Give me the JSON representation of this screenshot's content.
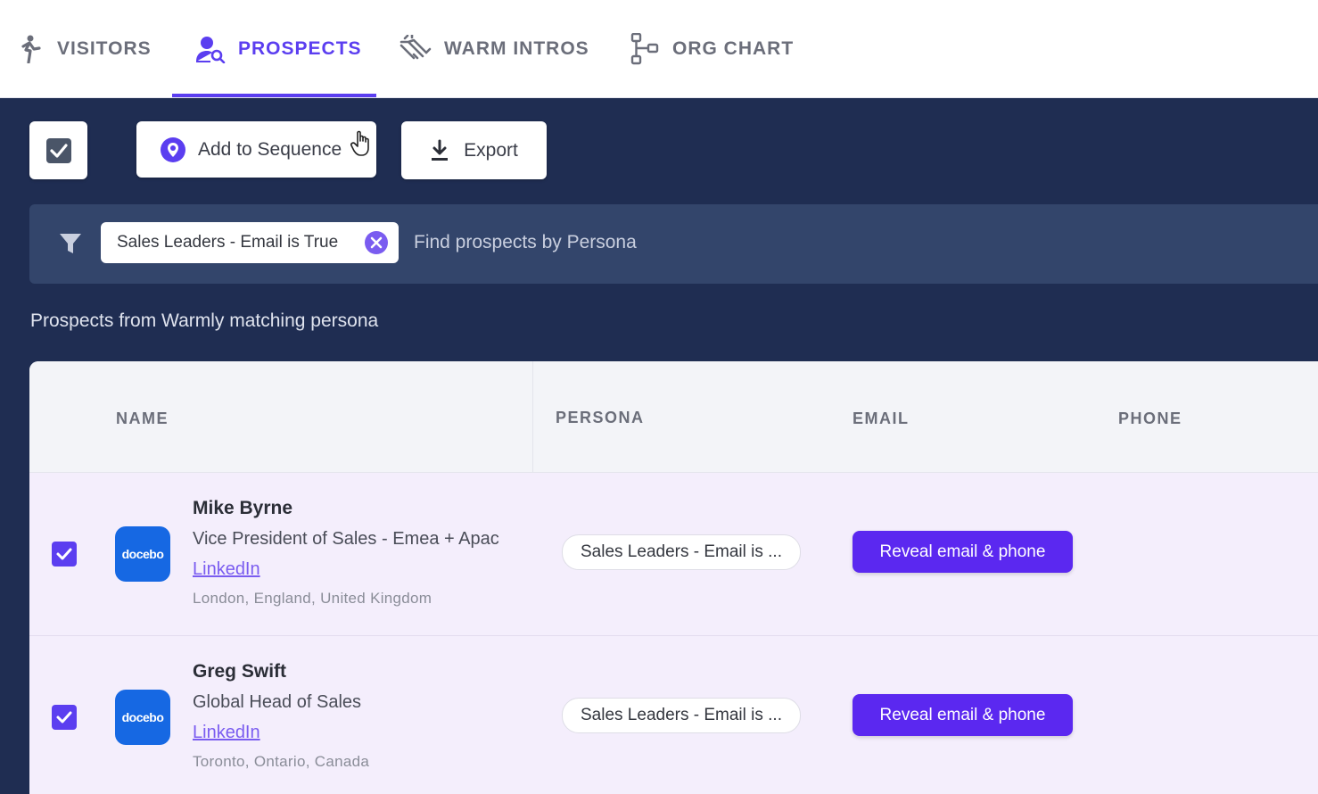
{
  "nav": {
    "tabs": [
      {
        "label": "VISITORS",
        "icon": "walking-person-icon"
      },
      {
        "label": "PROSPECTS",
        "icon": "person-search-icon",
        "active": true
      },
      {
        "label": "WARM INTROS",
        "icon": "handshake-icon"
      },
      {
        "label": "ORG CHART",
        "icon": "org-chart-icon"
      }
    ]
  },
  "toolbar": {
    "add_to_sequence_label": "Add to Sequence",
    "export_label": "Export"
  },
  "filter": {
    "chip_label": "Sales Leaders - Email is True",
    "placeholder": "Find prospects by Persona"
  },
  "caption": "Prospects from Warmly matching persona",
  "table": {
    "columns": [
      "NAME",
      "PERSONA",
      "EMAIL",
      "PHONE"
    ],
    "rows": [
      {
        "name": "Mike Byrne",
        "title": "Vice President of Sales - Emea + Apac",
        "link": "LinkedIn",
        "location": "London, England, United Kingdom",
        "company_logo": "docebo",
        "persona": "Sales Leaders - Email is ...",
        "action": "Reveal email & phone",
        "checked": true
      },
      {
        "name": "Greg Swift",
        "title": "Global Head of Sales",
        "link": "LinkedIn",
        "location": "Toronto, Ontario, Canada",
        "company_logo": "docebo",
        "persona": "Sales Leaders - Email is ...",
        "action": "Reveal email & phone",
        "checked": true
      }
    ]
  },
  "colors": {
    "accent": "#5b3ef0",
    "background": "#1f2d52",
    "filter_bar": "#33456b",
    "row_selected": "#f4eefc",
    "logo": "#1668e3"
  }
}
